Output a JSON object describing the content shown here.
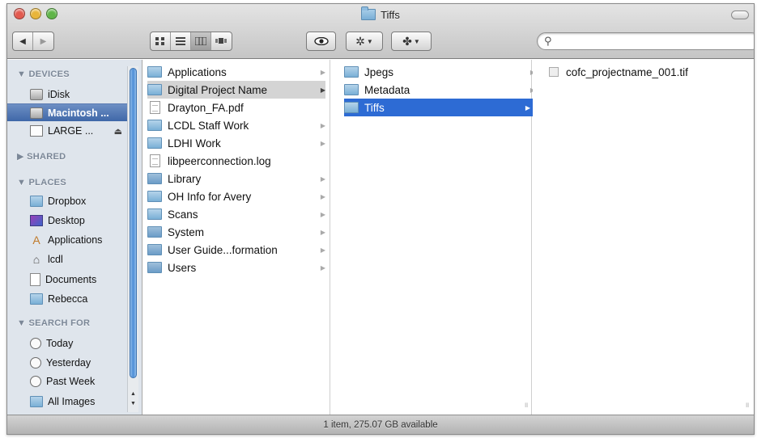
{
  "window": {
    "title": "Tiffs"
  },
  "toolbar": {
    "back_icon": "back-arrow-icon",
    "forward_icon": "forward-arrow-icon",
    "view_modes": [
      "icon-view",
      "list-view",
      "column-view",
      "coverflow-view"
    ],
    "active_view": "column-view",
    "quicklook_icon": "eye-icon",
    "action_icon": "gear-icon",
    "arrange_icon": "arrange-icon",
    "search": {
      "value": "",
      "placeholder": ""
    }
  },
  "sidebar": {
    "devices": {
      "heading": "▼ DEVICES",
      "items": [
        {
          "label": "iDisk",
          "icon": "idisk-icon"
        },
        {
          "label": "Macintosh ...",
          "icon": "hard-drive-icon",
          "selected": true
        },
        {
          "label": "LARGE ...",
          "icon": "external-drive-icon",
          "eject": "⏏"
        }
      ]
    },
    "shared": {
      "heading": "▶ SHARED"
    },
    "places": {
      "heading": "▼ PLACES",
      "items": [
        {
          "label": "Dropbox",
          "icon": "folder-icon"
        },
        {
          "label": "Desktop",
          "icon": "desktop-icon"
        },
        {
          "label": "Applications",
          "icon": "applications-icon"
        },
        {
          "label": "lcdl",
          "icon": "home-icon"
        },
        {
          "label": "Documents",
          "icon": "documents-icon"
        },
        {
          "label": "Rebecca",
          "icon": "folder-icon"
        }
      ]
    },
    "search_for": {
      "heading": "▼ SEARCH FOR",
      "items": [
        {
          "label": "Today",
          "icon": "clock-icon"
        },
        {
          "label": "Yesterday",
          "icon": "clock-icon"
        },
        {
          "label": "Past Week",
          "icon": "clock-icon"
        },
        {
          "label": "All Images",
          "icon": "images-folder-icon"
        }
      ]
    }
  },
  "columns": {
    "col1": [
      {
        "label": "Applications",
        "type": "folder",
        "chevron": "▶"
      },
      {
        "label": "Digital Project Name",
        "type": "folder",
        "chevron": "▶",
        "selected": "gray"
      },
      {
        "label": "Drayton_FA.pdf",
        "type": "file",
        "chevron": ""
      },
      {
        "label": "LCDL Staff Work",
        "type": "folder",
        "chevron": "▶"
      },
      {
        "label": "LDHI Work",
        "type": "folder",
        "chevron": "▶"
      },
      {
        "label": "libpeerconnection.log",
        "type": "file",
        "chevron": ""
      },
      {
        "label": "Library",
        "type": "folder",
        "chevron": "▶"
      },
      {
        "label": "OH Info for Avery",
        "type": "folder",
        "chevron": "▶"
      },
      {
        "label": "Scans",
        "type": "folder",
        "chevron": "▶"
      },
      {
        "label": "System",
        "type": "folder",
        "chevron": "▶"
      },
      {
        "label": "User Guide...formation",
        "type": "folder",
        "chevron": "▶"
      },
      {
        "label": "Users",
        "type": "folder",
        "chevron": "▶"
      }
    ],
    "col2": [
      {
        "label": "Jpegs",
        "type": "folder",
        "chevron": "▶"
      },
      {
        "label": "Metadata",
        "type": "folder",
        "chevron": "▶"
      },
      {
        "label": "Tiffs",
        "type": "folder",
        "chevron": "▶",
        "selected": "blue"
      }
    ],
    "col3": [
      {
        "label": "cofc_projectname_001.tif",
        "type": "image"
      }
    ]
  },
  "status": {
    "text": "1 item, 275.07 GB available"
  }
}
